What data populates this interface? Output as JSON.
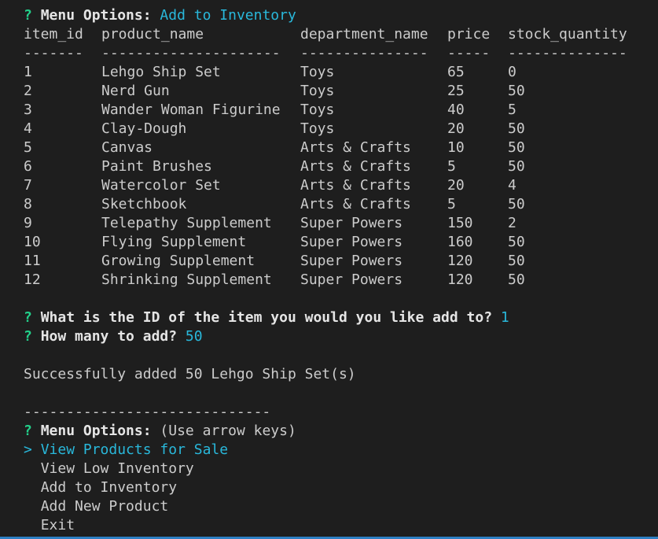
{
  "prompt1": {
    "marker": "?",
    "label": "Menu Options:",
    "answer": "Add to Inventory"
  },
  "table": {
    "headers": [
      "item_id",
      "product_name",
      "department_name",
      "price",
      "stock_quantity"
    ],
    "separators": [
      "-------",
      "---------------------",
      "---------------",
      "-----",
      "--------------"
    ],
    "rows": [
      [
        "1",
        "Lehgo Ship Set",
        "Toys",
        "65",
        "0"
      ],
      [
        "2",
        "Nerd Gun",
        "Toys",
        "25",
        "50"
      ],
      [
        "3",
        "Wander Woman Figurine",
        "Toys",
        "40",
        "5"
      ],
      [
        "4",
        "Clay-Dough",
        "Toys",
        "20",
        "50"
      ],
      [
        "5",
        "Canvas",
        "Arts & Crafts",
        "10",
        "50"
      ],
      [
        "6",
        "Paint Brushes",
        "Arts & Crafts",
        "5",
        "50"
      ],
      [
        "7",
        "Watercolor Set",
        "Arts & Crafts",
        "20",
        "4"
      ],
      [
        "8",
        "Sketchbook",
        "Arts & Crafts",
        "5",
        "50"
      ],
      [
        "9",
        "Telepathy Supplement",
        "Super Powers",
        "150",
        "2"
      ],
      [
        "10",
        "Flying Supplement",
        "Super Powers",
        "160",
        "50"
      ],
      [
        "11",
        "Growing Supplement",
        "Super Powers",
        "120",
        "50"
      ],
      [
        "12",
        "Shrinking Supplement",
        "Super Powers",
        "120",
        "50"
      ]
    ]
  },
  "prompt2": {
    "marker": "?",
    "label": "What is the ID of the item you would you like add to?",
    "answer": "1"
  },
  "prompt3": {
    "marker": "?",
    "label": "How many to add?",
    "answer": "50"
  },
  "success_message": "Successfully added 50 Lehgo Ship Set(s)",
  "divider": "-----------------------------",
  "menu": {
    "marker": "?",
    "label": "Menu Options:",
    "hint": "(Use arrow keys)",
    "pointer": ">",
    "options": [
      "View Products for Sale",
      "View Low Inventory",
      "Add to Inventory",
      "Add New Product",
      "Exit"
    ]
  },
  "colors": {
    "background": "#1e1e1e",
    "text": "#cccccc",
    "question_mark": "#23d18b",
    "answer": "#29b8db",
    "status_bar": "#2d7fc3"
  }
}
